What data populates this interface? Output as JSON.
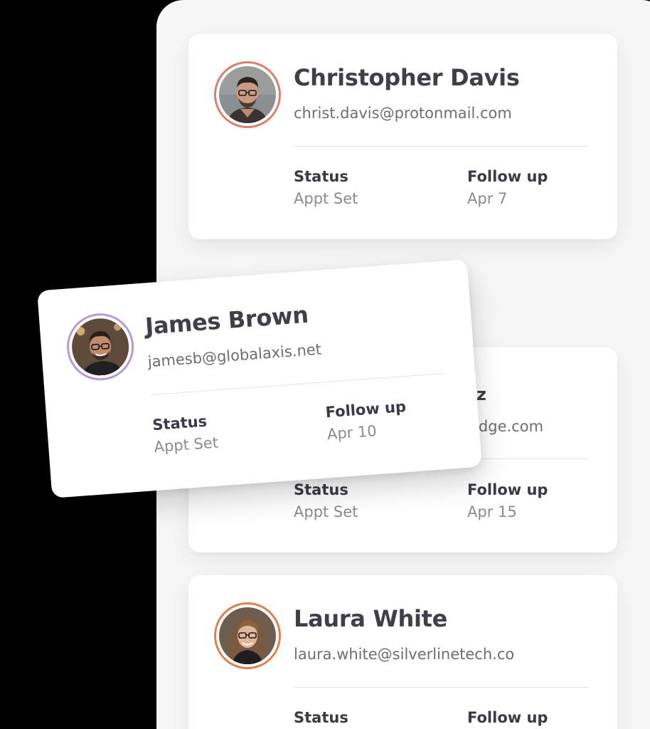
{
  "contacts": [
    {
      "name": "Christopher Davis",
      "email": "christ.davis@protonmail.com",
      "status_label": "Status",
      "status_value": "Appt Set",
      "followup_label": "Follow up",
      "followup_value": "Apr 7",
      "avatar_ring_color": "#d9806a"
    },
    {
      "name_fragment": "z",
      "email_fragment": "edge.com",
      "status_label": "Status",
      "status_value": "Appt Set",
      "followup_label": "Follow up",
      "followup_value": "Apr 15"
    },
    {
      "name": "James Brown",
      "email": "jamesb@globalaxis.net",
      "status_label": "Status",
      "status_value": "Appt Set",
      "followup_label": "Follow up",
      "followup_value": "Apr 10",
      "avatar_ring_color": "#b79ad3"
    },
    {
      "name": "Laura White",
      "email": "laura.white@silverlinetech.co",
      "status_label": "Status",
      "followup_label": "Follow up",
      "avatar_ring_color": "#e0804e"
    }
  ]
}
